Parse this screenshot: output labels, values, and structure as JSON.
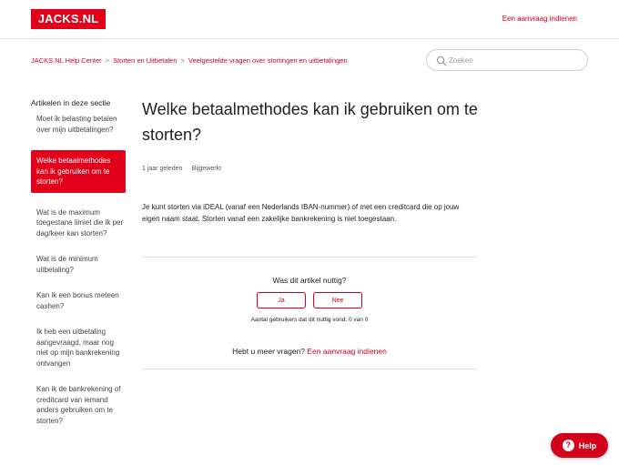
{
  "header": {
    "logo_text": "JACKS.NL",
    "request_link": "Een aanvraag indienen"
  },
  "breadcrumb": {
    "items": [
      "JACKS.NL Help Center",
      "Storten en Uitbetalen",
      "Veelgestelde vragen over stortingen en uitbetalingen"
    ],
    "separator": ">"
  },
  "search": {
    "placeholder": "Zoeken"
  },
  "sidebar": {
    "title": "Artikelen in deze sectie",
    "items": [
      {
        "label": "Moet ik belasting betalen over mijn uitbetalingen?",
        "active": false
      },
      {
        "label": "Welke betaalmethodes kan ik gebruiken om te storten?",
        "active": true
      },
      {
        "label": "Wat is de maximum toegestane limiet die ik per dag/keer kan storten?",
        "active": false
      },
      {
        "label": "Wat is de minimum uitbetaling?",
        "active": false
      },
      {
        "label": "Kan ik een bonus meteen cashen?",
        "active": false
      },
      {
        "label": "Ik heb een uitbetaling aangevraagd, maar nog niet op mijn bankrekening ontvangen",
        "active": false
      },
      {
        "label": "Kan ik de bankrekening of creditcard van iemand anders gebruiken om te storten?",
        "active": false
      }
    ]
  },
  "article": {
    "title": "Welke betaalmethodes kan ik gebruiken om te storten?",
    "time": "1 jaar geleden",
    "meta_separator": "·",
    "updated": "Bijgewerkt",
    "body": "Je kunt storten via iDEAL (vanaf een Nederlands IBAN-nummer) of met een creditcard die op jouw eigen naam staat. Storten vanaf een zakelijke bankrekening is niet toegestaan."
  },
  "vote": {
    "question": "Was dit artikel nuttig?",
    "yes_label": "Ja",
    "no_label": "Nee",
    "count_text": "Aantal gebruikers dat dit nuttig vond: 0 van 0"
  },
  "more_questions": {
    "text": "Hebt u meer vragen?",
    "link": "Een aanvraag indienen"
  },
  "help_button": {
    "icon": "?",
    "label": "Help"
  },
  "colors": {
    "brand_red": "#e3001b",
    "link_red": "#d4001a"
  }
}
